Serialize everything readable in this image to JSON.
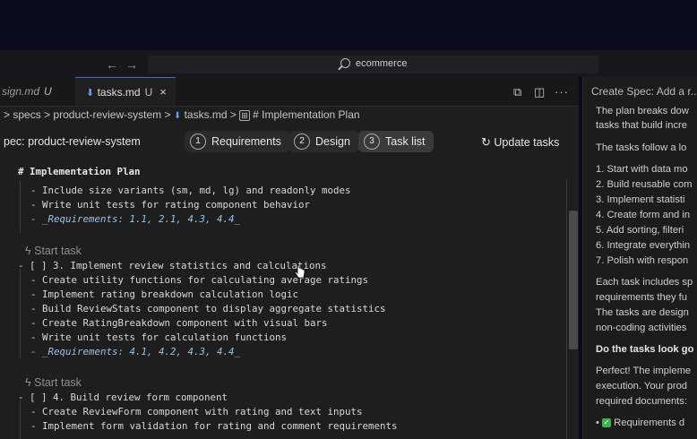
{
  "search": {
    "text": "ecommerce"
  },
  "tabs": [
    {
      "label": "sign.md",
      "modified": "U"
    },
    {
      "label": "tasks.md",
      "modified": "U",
      "close": "×"
    }
  ],
  "breadcrumb": {
    "parts": [
      "specs",
      "product-review-system",
      "tasks.md",
      "# Implementation Plan"
    ],
    "sep": ">"
  },
  "spec": {
    "title": "pec: product-review-system",
    "steps": [
      {
        "num": "1",
        "label": "Requirements"
      },
      {
        "num": "2",
        "label": "Design"
      },
      {
        "num": "3",
        "label": "Task list"
      }
    ],
    "update_label": "Update tasks"
  },
  "editor": {
    "header": "# Implementation Plan",
    "block1": [
      "- Include size variants (sm, md, lg) and readonly modes",
      "- Write unit tests for rating component behavior"
    ],
    "block1_req": "- _Requirements: 1.1, 2.1, 4.3, 4.4_",
    "codelens1": "Start task",
    "block2": [
      "- [ ] 3. Implement review statistics and calculations",
      "- Create utility functions for calculating average ratings",
      "- Implement rating breakdown calculation logic",
      "- Build ReviewStats component to display aggregate statistics",
      "- Create RatingBreakdown component with visual bars",
      "- Write unit tests for calculation functions"
    ],
    "block2_req": "- _Requirements: 4.1, 4.2, 4.3, 4.4_",
    "codelens2": "Start task",
    "block3": [
      "- [ ] 4. Build review form component",
      "- Create ReviewForm component with rating and text inputs",
      "- Implement form validation for rating and comment requirements"
    ]
  },
  "chat": {
    "header": "Create Spec: Add a r...",
    "p1": [
      "The plan breaks dow",
      "tasks that build incre"
    ],
    "p2": "The tasks follow a lo",
    "list": [
      "1. Start with data mo",
      "2. Build reusable com",
      "3. Implement statisti",
      "4. Create form and in",
      "5. Add sorting, filteri",
      "6. Integrate everythin",
      "7. Polish with respon"
    ],
    "p3": [
      "Each task includes sp",
      "requirements they fu",
      "The tasks are design",
      "non-coding activities"
    ],
    "bold": "Do the tasks look go",
    "p4": [
      "Perfect! The impleme",
      "execution. Your prod",
      "required documents:"
    ],
    "bullet": "Requirements d"
  }
}
